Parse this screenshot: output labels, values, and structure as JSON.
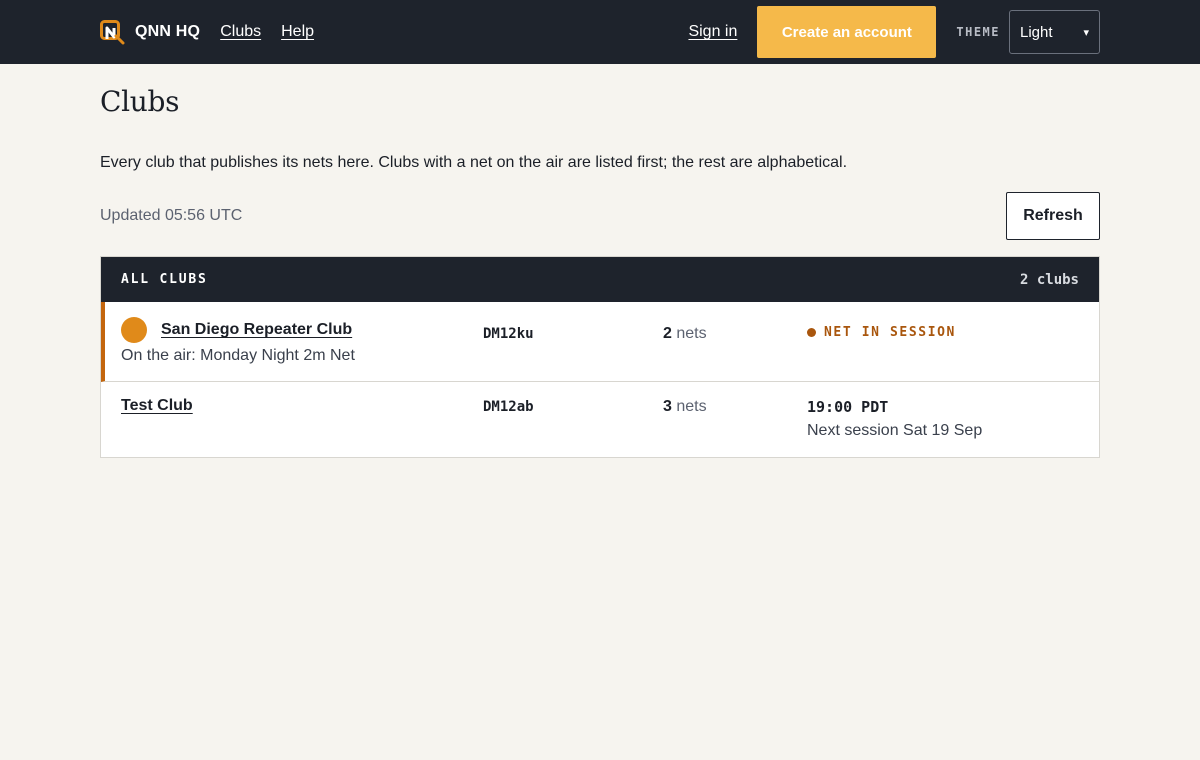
{
  "header": {
    "brand": "QNN HQ",
    "nav": [
      "Clubs",
      "Help"
    ],
    "signin": "Sign in",
    "cta": "Create an account",
    "theme_label": "THEME",
    "theme_value": "Light"
  },
  "page": {
    "title": "Clubs",
    "intro": "Every club that publishes its nets here. Clubs with a net on the air are listed first; the rest are alphabetical.",
    "updated": "Updated 05:56 UTC",
    "refresh": "Refresh"
  },
  "table": {
    "heading": "ALL CLUBS",
    "count": "2 clubs",
    "rows": [
      {
        "name": "San Diego Repeater Club",
        "on_air": "On the air: Monday Night 2m Net",
        "grid": "DM12ku",
        "net_count": "2",
        "net_label": "nets",
        "status": "NET IN SESSION"
      },
      {
        "name": "Test Club",
        "grid": "DM12ab",
        "net_count": "3",
        "net_label": "nets",
        "time": "19:00 PDT",
        "next": "Next session Sat 19 Sep"
      }
    ]
  },
  "colors": {
    "topbar": "#1e232c",
    "accent": "#f5b94a",
    "live": "#c3650d",
    "background": "#f6f4ef"
  }
}
